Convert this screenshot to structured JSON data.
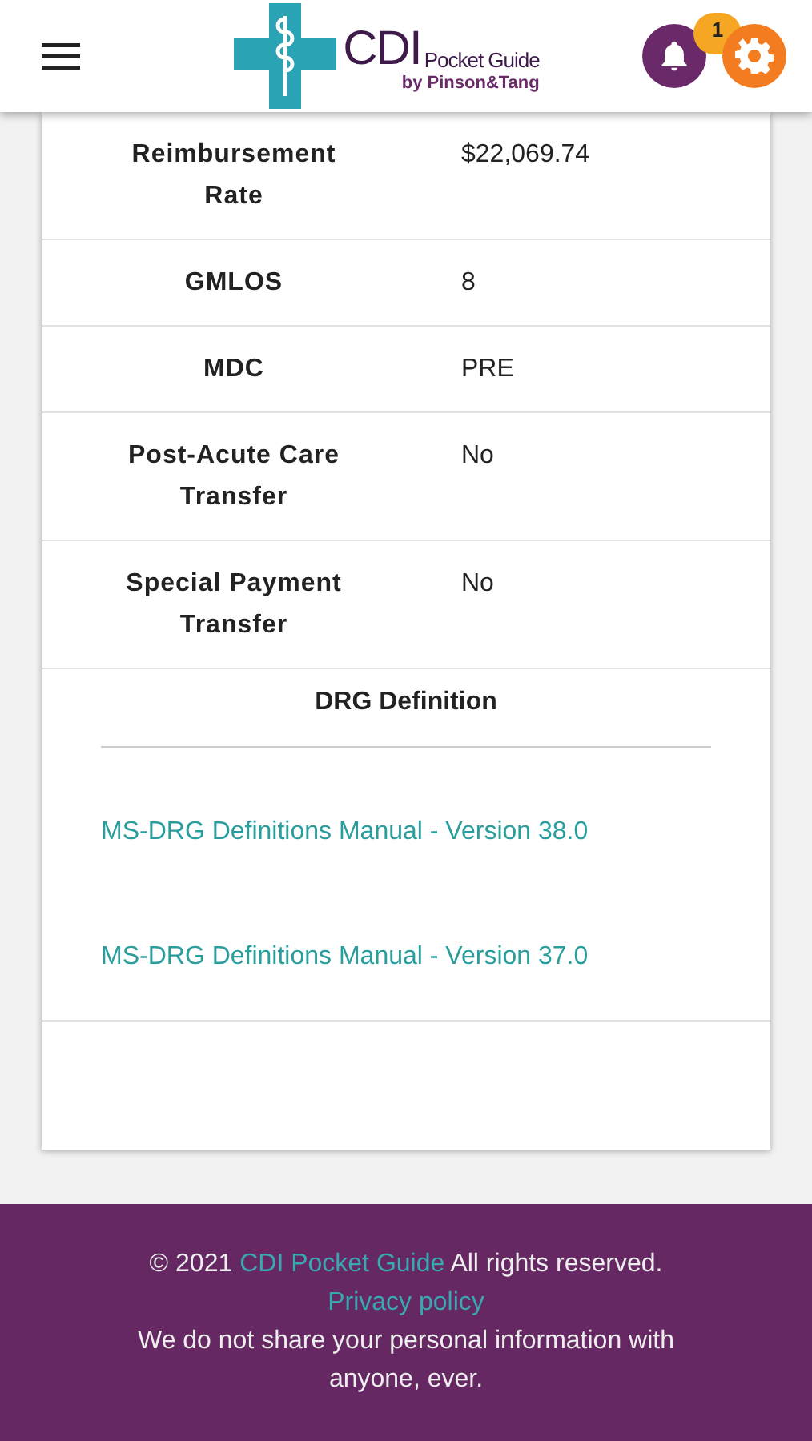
{
  "header": {
    "logo": {
      "mark": "CDI",
      "name": "Pocket Guide",
      "byline": "by Pinson&Tang"
    },
    "notification_count": "1"
  },
  "details": [
    {
      "label": "Reimbursement Rate",
      "value": "$22,069.74"
    },
    {
      "label": "GMLOS",
      "value": "8"
    },
    {
      "label": "MDC",
      "value": "PRE"
    },
    {
      "label": "Post-Acute Care Transfer",
      "value": "No"
    },
    {
      "label": "Special Payment Transfer",
      "value": "No"
    }
  ],
  "definition": {
    "title": "DRG Definition",
    "links": [
      "MS-DRG Definitions Manual - Version 38.0",
      "MS-DRG Definitions Manual - Version 37.0"
    ]
  },
  "footer": {
    "copyright": "© 2021",
    "brand_link": "CDI Pocket Guide",
    "rights": "All rights reserved.",
    "privacy_link": "Privacy policy",
    "notice": "We do not share your personal information with anyone, ever."
  }
}
